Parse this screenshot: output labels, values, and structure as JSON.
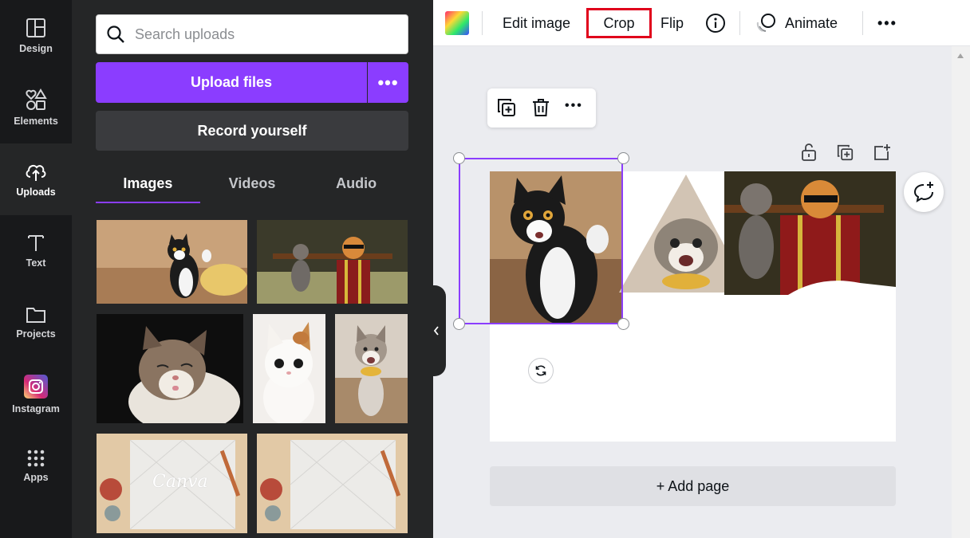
{
  "rail": {
    "items": [
      {
        "label": "Design",
        "icon": "design-icon"
      },
      {
        "label": "Elements",
        "icon": "elements-icon"
      },
      {
        "label": "Uploads",
        "icon": "uploads-icon"
      },
      {
        "label": "Text",
        "icon": "text-icon"
      },
      {
        "label": "Projects",
        "icon": "folder-icon"
      },
      {
        "label": "Instagram",
        "icon": "instagram-icon"
      },
      {
        "label": "Apps",
        "icon": "apps-icon"
      }
    ],
    "active": "Uploads"
  },
  "panel": {
    "search_placeholder": "Search uploads",
    "upload_label": "Upload files",
    "record_label": "Record yourself",
    "tabs": [
      "Images",
      "Videos",
      "Audio"
    ],
    "active_tab": "Images",
    "thumbnail_text": "Canva"
  },
  "toolbar": {
    "edit_image": "Edit image",
    "crop": "Crop",
    "flip": "Flip",
    "animate": "Animate"
  },
  "canvas": {
    "add_page": "+ Add page"
  },
  "colors": {
    "accent": "#8b3dff",
    "highlight": "#e0001b"
  }
}
